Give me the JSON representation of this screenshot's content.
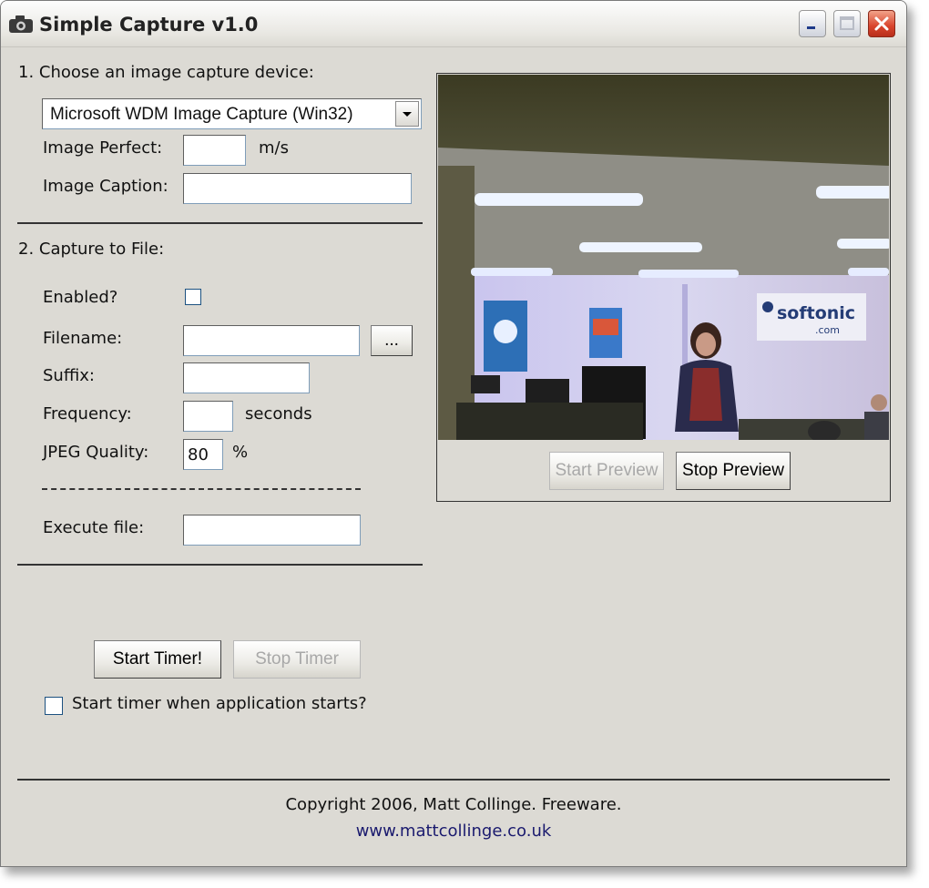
{
  "window": {
    "title": "Simple Capture v1.0",
    "controls": [
      "minimize",
      "maximize",
      "close"
    ]
  },
  "section1": {
    "heading": "1. Choose an image capture device:",
    "device_select": {
      "value": "Microsoft WDM Image Capture (Win32)"
    },
    "image_perfect": {
      "label": "Image Perfect:",
      "value": "",
      "unit": "m/s"
    },
    "image_caption": {
      "label": "Image Caption:",
      "value": ""
    }
  },
  "section2": {
    "heading": "2. Capture to File:",
    "enabled": {
      "label": "Enabled?",
      "checked": false
    },
    "filename": {
      "label": "Filename:",
      "value": "",
      "browse_label": "..."
    },
    "suffix": {
      "label": "Suffix:",
      "value": ""
    },
    "frequency": {
      "label": "Frequency:",
      "value": "",
      "unit": "seconds"
    },
    "jpeg_quality": {
      "label": "JPEG Quality:",
      "value": "80",
      "unit": "%"
    },
    "execute_file": {
      "label": "Execute file:",
      "value": ""
    }
  },
  "timer": {
    "start_label": "Start Timer!",
    "stop_label": "Stop Timer",
    "autostart_label": "Start timer when application starts?",
    "autostart_checked": false
  },
  "preview": {
    "start_label": "Start Preview",
    "stop_label": "Stop Preview",
    "sign_text": "softonic",
    "sign_sub": ".com"
  },
  "footer": {
    "copyright": "Copyright 2006, Matt Collinge. Freeware.",
    "url": "www.mattcollinge.co.uk"
  },
  "colors": {
    "window_bg": "#dcdad4",
    "link": "#1a1a6e",
    "close_button": "#d9442c"
  }
}
